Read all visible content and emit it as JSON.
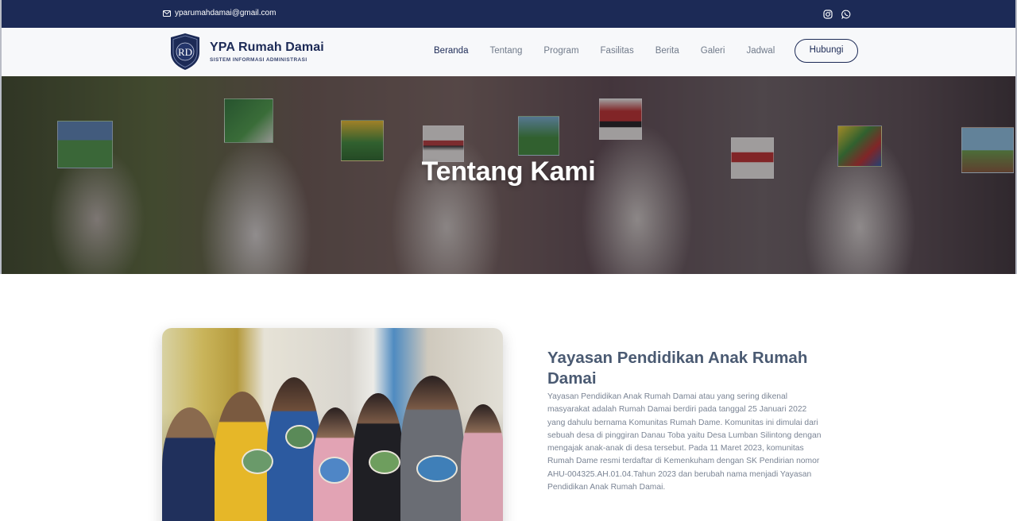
{
  "topbar": {
    "email": "yparumahdamai@gmail.com",
    "icons": [
      "mail-icon",
      "instagram-icon",
      "whatsapp-icon"
    ]
  },
  "brand": {
    "title": "YPA Rumah Damai",
    "subtitle": "SISTEM INFORMASI ADMINISTRASI",
    "logo_letters": "RD"
  },
  "nav": {
    "items": [
      {
        "label": "Beranda",
        "active": true
      },
      {
        "label": "Tentang",
        "active": false
      },
      {
        "label": "Program",
        "active": false
      },
      {
        "label": "Fasilitas",
        "active": false
      },
      {
        "label": "Berita",
        "active": false
      },
      {
        "label": "Galeri",
        "active": false
      },
      {
        "label": "Jadwal",
        "active": false
      }
    ],
    "cta": "Hubungi"
  },
  "hero": {
    "title": "Tentang Kami"
  },
  "about": {
    "title": "Yayasan Pendidikan Anak Rumah Damai",
    "body": "Yayasan Pendidikan Anak Rumah Damai atau yang sering dikenal masyarakat adalah Rumah Damai berdiri pada tanggal 25 Januari 2022 yang dahulu bernama Komunitas Rumah Dame. Komunitas ini dimulai dari sebuah desa di pinggiran Danau Toba yaitu Desa Lumban Silintong dengan mengajak anak-anak di desa tersebut. Pada 11 Maret 2023, komunitas Rumah Dame resmi terdaftar di Kemenkuham dengan SK Pendirian nomor AHU-004325.AH.01.04.Tahun 2023 dan berubah nama menjadi Yayasan Pendidikan Anak Rumah Damai."
  },
  "colors": {
    "navy": "#1c2a56",
    "muted_text": "#7a8494",
    "heading": "#4a5a72"
  }
}
